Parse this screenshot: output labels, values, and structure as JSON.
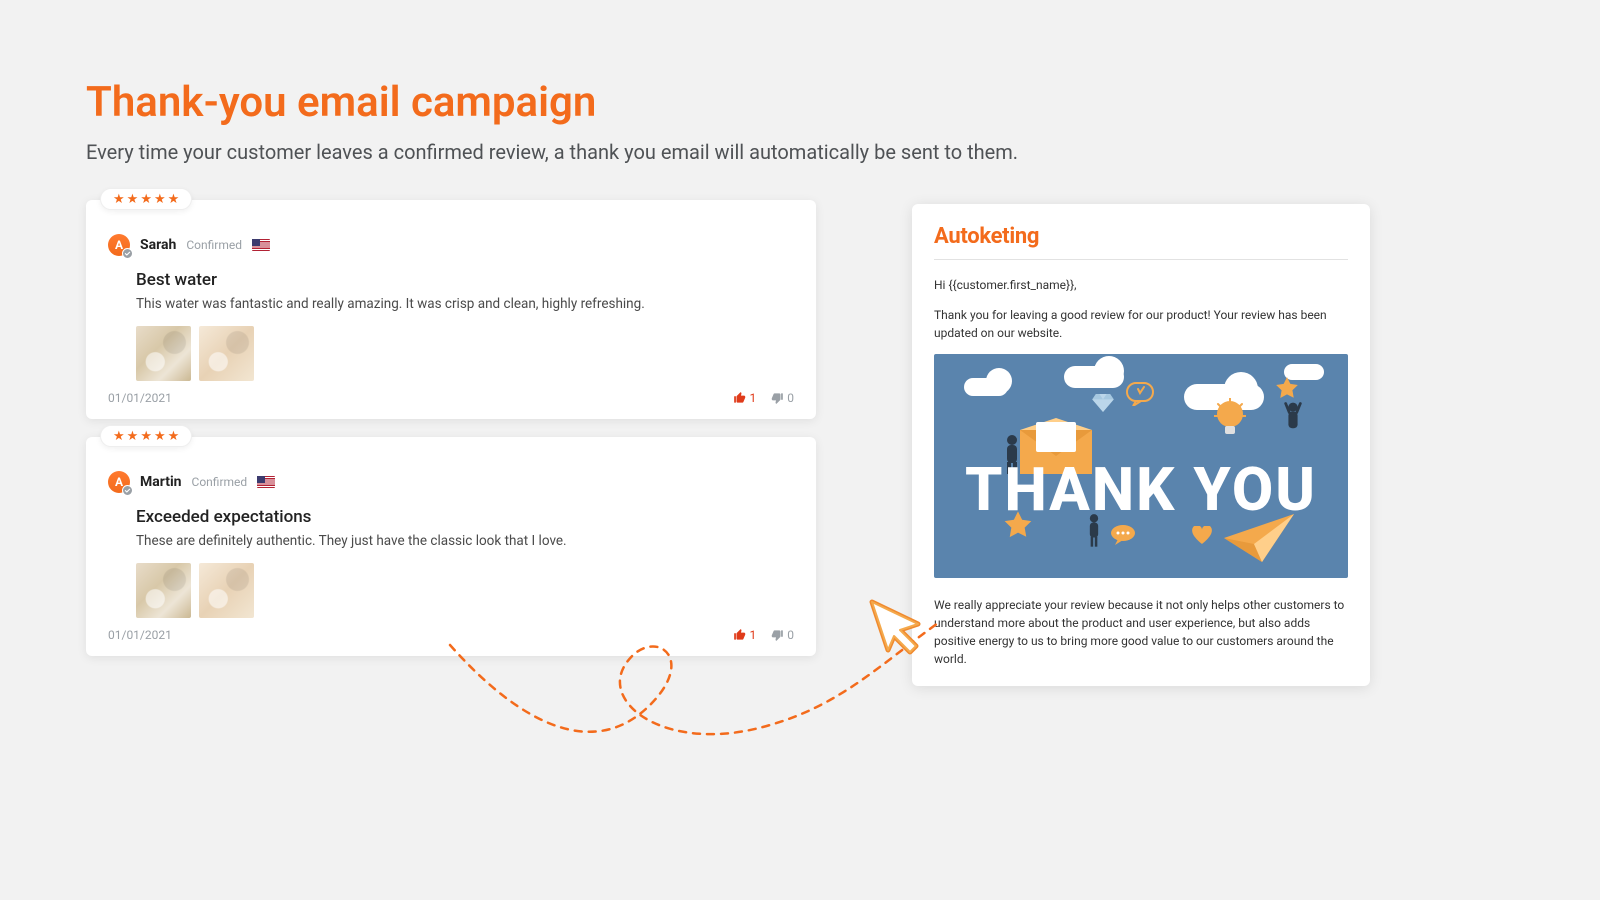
{
  "page": {
    "title": "Thank-you email campaign",
    "subtitle": "Every time your customer leaves a confirmed review, a thank you email will automatically be sent to them."
  },
  "reviews": [
    {
      "avatar_initial": "A",
      "author": "Sarah",
      "status": "Confirmed",
      "title": "Best water",
      "body": "This water was fantastic and really amazing. It was crisp and clean, highly refreshing.",
      "date": "01/01/2021",
      "upvotes": "1",
      "downvotes": "0"
    },
    {
      "avatar_initial": "A",
      "author": "Martin",
      "status": "Confirmed",
      "title": "Exceeded expectations",
      "body": "These are definitely authentic. They just have the classic look that I love.",
      "date": "01/01/2021",
      "upvotes": "1",
      "downvotes": "0"
    }
  ],
  "email": {
    "brand": "Autoketing",
    "greeting": "Hi {{customer.first_name}},",
    "intro": "Thank you for leaving a good review for our product! Your review has been updated on our website.",
    "hero_text": "THANK YOU",
    "footer": "We really appreciate your review because it not only helps other customers to understand more about the product and user experience, but also adds positive energy to us to bring more good value to our customers around the world."
  }
}
